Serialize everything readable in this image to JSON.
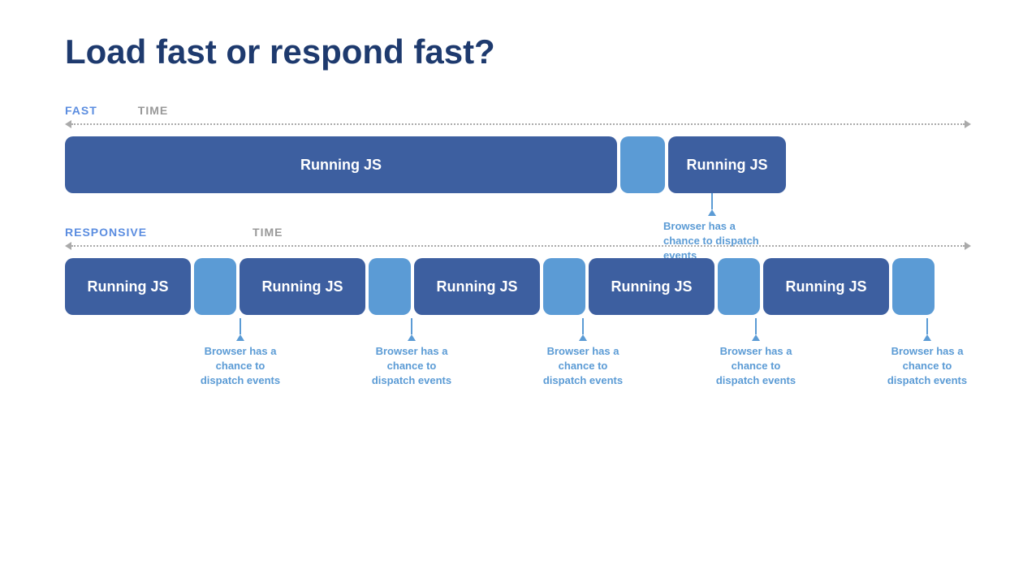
{
  "title": "Load fast or respond fast?",
  "fast_section": {
    "label": "FAST",
    "time_label": "TIME",
    "running_js_label": "Running JS",
    "running_js2_label": "Running JS",
    "browser_annotation": "Browser has a chance to dispatch events"
  },
  "responsive_section": {
    "label": "RESPONSIVE",
    "time_label": "TIME",
    "running_js_label": "Running JS",
    "browser_annotation": "Browser has a chance to dispatch events",
    "blocks": [
      {
        "type": "large",
        "label": "Running JS"
      },
      {
        "type": "small",
        "label": ""
      },
      {
        "type": "large",
        "label": "Running JS"
      },
      {
        "type": "small",
        "label": ""
      },
      {
        "type": "large",
        "label": "Running JS"
      },
      {
        "type": "small",
        "label": ""
      },
      {
        "type": "large",
        "label": "Running JS"
      },
      {
        "type": "small",
        "label": ""
      },
      {
        "type": "large",
        "label": "Running JS"
      },
      {
        "type": "small",
        "label": ""
      }
    ],
    "annotations": [
      "Browser has a chance to dispatch events",
      "Browser has a chance to dispatch events",
      "Browser has a chance to dispatch events",
      "Browser has a chance to dispatch events",
      "Browser has a chance to dispatch events"
    ]
  },
  "colors": {
    "title": "#1e3a6e",
    "label_fast": "#5b8de0",
    "label_time": "#999999",
    "block_dark": "#3d5fa0",
    "block_light": "#5b9bd5",
    "annotation": "#5b9bd5"
  }
}
